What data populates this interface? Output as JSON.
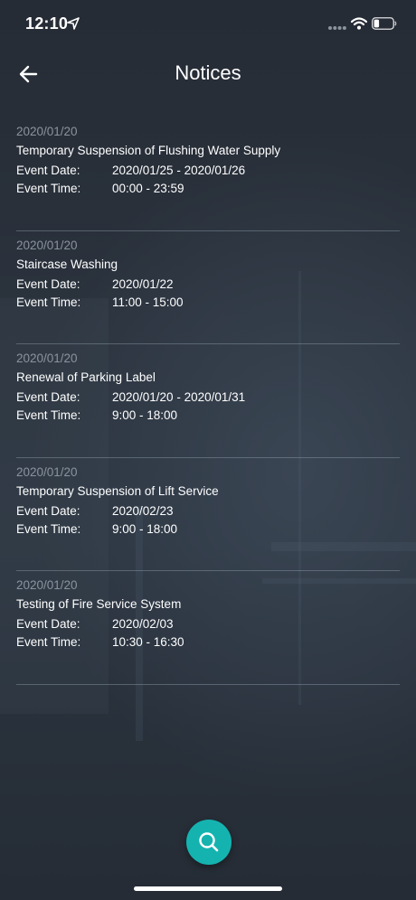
{
  "status_bar": {
    "time": "12:10",
    "icons": [
      "location-arrow-icon",
      "signal-icon",
      "wifi-icon",
      "battery-icon"
    ]
  },
  "header": {
    "title": "Notices",
    "back_icon": "arrow-left-icon"
  },
  "notices": [
    {
      "posted": "2020/01/20",
      "title": "Temporary Suspension of Flushing Water Supply",
      "date_label": "Event Date:",
      "date_value": "2020/01/25 - 2020/01/26",
      "time_label": "Event Time:",
      "time_value": "00:00 - 23:59"
    },
    {
      "posted": "2020/01/20",
      "title": "Staircase Washing",
      "date_label": "Event Date:",
      "date_value": "2020/01/22",
      "time_label": "Event Time:",
      "time_value": "11:00 - 15:00"
    },
    {
      "posted": "2020/01/20",
      "title": "Renewal of Parking Label",
      "date_label": "Event Date:",
      "date_value": "2020/01/20 - 2020/01/31",
      "time_label": "Event Time:",
      "time_value": "9:00 - 18:00"
    },
    {
      "posted": "2020/01/20",
      "title": "Temporary Suspension of Lift Service",
      "date_label": "Event Date:",
      "date_value": "2020/02/23",
      "time_label": "Event Time:",
      "time_value": "9:00 - 18:00"
    },
    {
      "posted": "2020/01/20",
      "title": "Testing of Fire Service System",
      "date_label": "Event Date:",
      "date_value": "2020/02/03",
      "time_label": "Event Time:",
      "time_value": "10:30 - 16:30"
    }
  ],
  "fab": {
    "icon": "search-icon"
  },
  "colors": {
    "background": "#262d36",
    "accent": "#15b3b0",
    "muted_text": "#8a939e"
  }
}
